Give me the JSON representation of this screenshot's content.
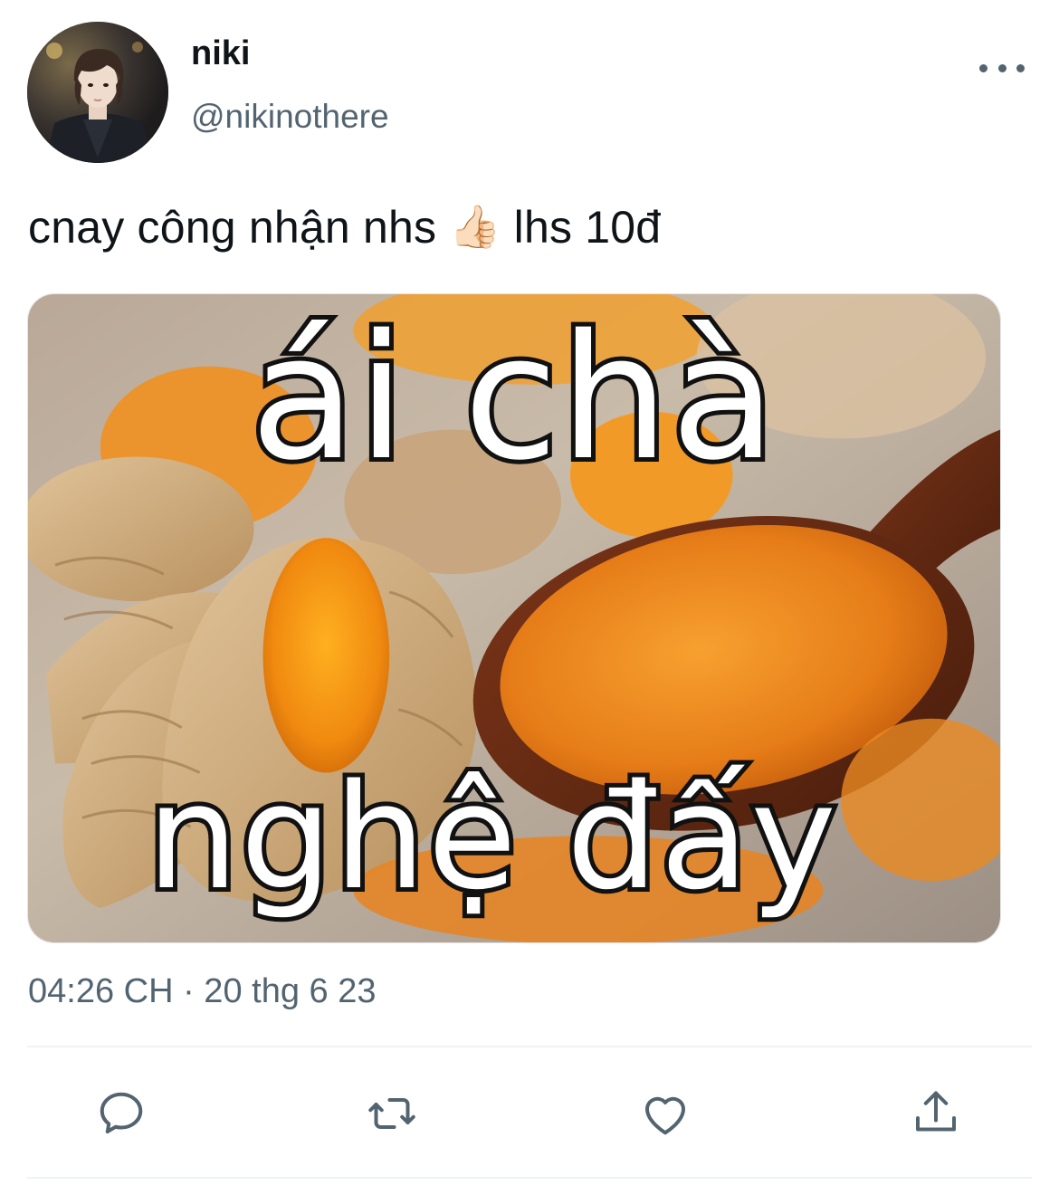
{
  "author": {
    "display_name": "niki",
    "handle": "@nikinothere"
  },
  "tweet": {
    "text_before_emoji": "cnay công nhận nhs",
    "emoji": "👍🏻",
    "text_after_emoji": "lhs 10đ",
    "timestamp": "04:26 CH · 20 thg 6 23"
  },
  "media": {
    "caption_top": "ái chà",
    "caption_bottom": "nghệ đấy"
  },
  "actions": {
    "reply_icon": "comment-icon",
    "retweet_icon": "retweet-icon",
    "like_icon": "heart-icon",
    "share_icon": "share-icon"
  },
  "colors": {
    "text_primary": "#0f1419",
    "text_secondary": "#536471",
    "divider": "#eff3f4"
  }
}
